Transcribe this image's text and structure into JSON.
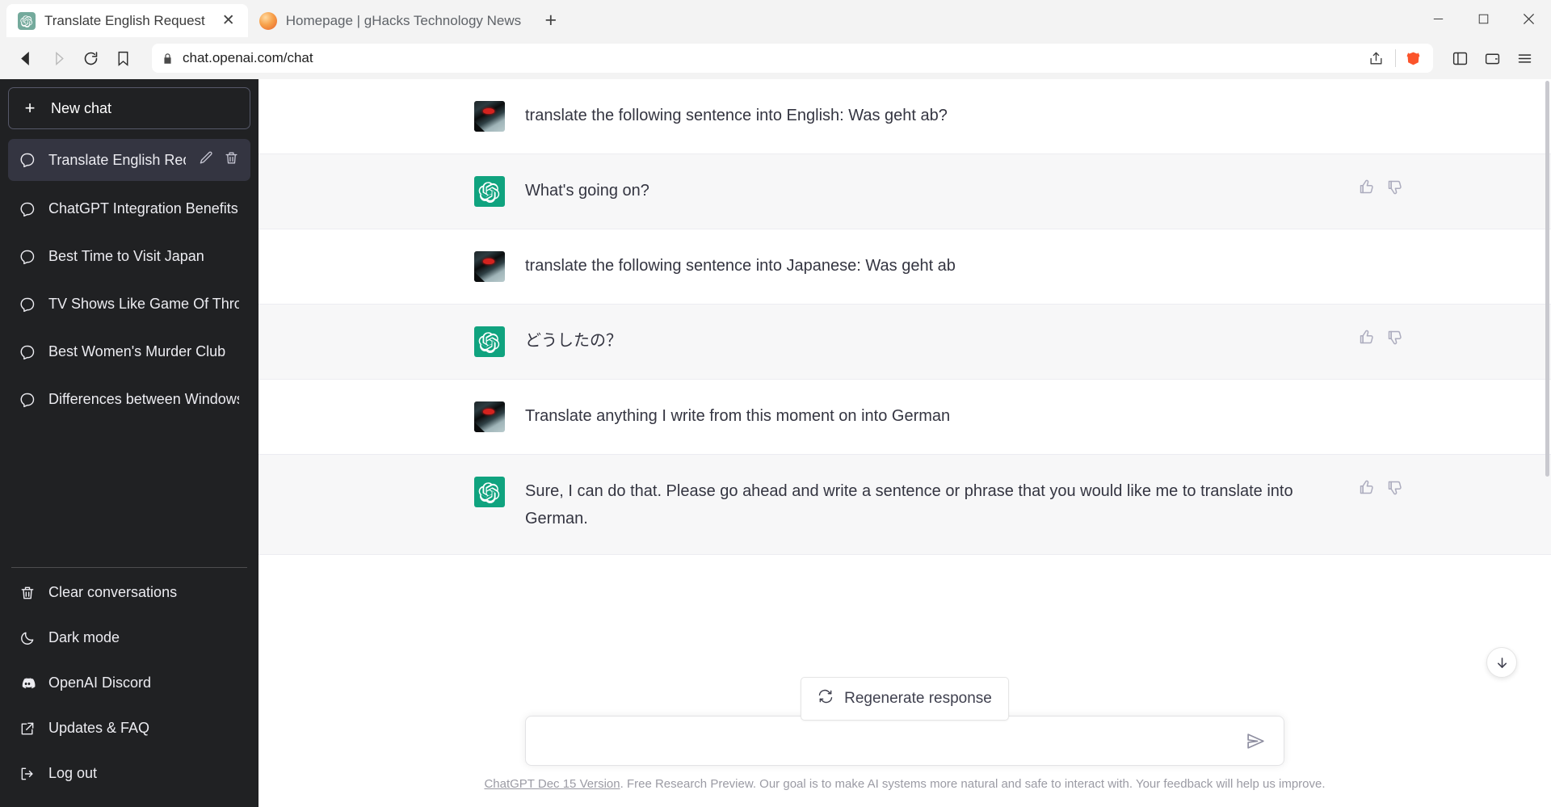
{
  "browser": {
    "tabs": [
      {
        "title": "Translate English Request",
        "favicon": "openai-icon",
        "active": true,
        "close_label": "✕"
      },
      {
        "title": "Homepage | gHacks Technology News",
        "favicon": "ghacks-icon",
        "active": false,
        "close_label": ""
      }
    ],
    "new_tab_label": "+",
    "window_controls": {
      "minimize": "minimize-icon",
      "maximize": "maximize-icon",
      "close": "close-icon"
    },
    "toolbar": {
      "back": "back-arrow-icon",
      "forward": "forward-arrow-icon",
      "reload": "reload-icon",
      "bookmark": "bookmark-icon",
      "url": "chat.openai.com/chat",
      "lock": "lock-icon",
      "share": "share-icon",
      "brave_shields": "brave-lion-icon",
      "sidebar_toggle": "sidebar-panel-icon",
      "wallet": "wallet-icon",
      "menu": "hamburger-menu-icon"
    }
  },
  "sidebar": {
    "new_chat_label": "New chat",
    "new_chat_plus": "+",
    "conversations": [
      {
        "label": "Translate English Reque",
        "active": true,
        "icon": "chat-bubble-icon",
        "edit": "pencil-icon",
        "delete": "trash-icon"
      },
      {
        "label": "ChatGPT Integration Benefits",
        "active": false,
        "icon": "chat-bubble-icon"
      },
      {
        "label": "Best Time to Visit Japan",
        "active": false,
        "icon": "chat-bubble-icon"
      },
      {
        "label": "TV Shows Like Game Of Thron",
        "active": false,
        "icon": "chat-bubble-icon"
      },
      {
        "label": "Best Women's Murder Club",
        "active": false,
        "icon": "chat-bubble-icon"
      },
      {
        "label": "Differences between Windows",
        "active": false,
        "icon": "chat-bubble-icon"
      }
    ],
    "menu": [
      {
        "label": "Clear conversations",
        "icon": "trash-icon"
      },
      {
        "label": "Dark mode",
        "icon": "moon-icon"
      },
      {
        "label": "OpenAI Discord",
        "icon": "discord-icon"
      },
      {
        "label": "Updates & FAQ",
        "icon": "external-link-icon"
      },
      {
        "label": "Log out",
        "icon": "logout-icon"
      }
    ]
  },
  "chat": {
    "messages": [
      {
        "role": "user",
        "text": "translate the following sentence into English: Was geht ab?"
      },
      {
        "role": "assistant",
        "text": "What's going on?",
        "thumbs_up": "thumbs-up-icon",
        "thumbs_down": "thumbs-down-icon"
      },
      {
        "role": "user",
        "text": "translate the following sentence into Japanese: Was geht ab"
      },
      {
        "role": "assistant",
        "text": "どうしたの？",
        "thumbs_up": "thumbs-up-icon",
        "thumbs_down": "thumbs-down-icon"
      },
      {
        "role": "user",
        "text": "Translate anything I write from this moment on into German"
      },
      {
        "role": "assistant",
        "text": "Sure, I can do that. Please go ahead and write a sentence or phrase that you would like me to translate into German.",
        "thumbs_up": "thumbs-up-icon",
        "thumbs_down": "thumbs-down-icon"
      }
    ],
    "regenerate_label": "Regenerate response",
    "regenerate_icon": "refresh-icon",
    "scroll_down_icon": "arrow-down-icon",
    "composer": {
      "value": "",
      "placeholder": "",
      "send_icon": "send-icon"
    },
    "footer": {
      "link_text": "ChatGPT Dec 15 Version",
      "rest_text": ". Free Research Preview. Our goal is to make AI systems more natural and safe to interact with. Your feedback will help us improve."
    }
  },
  "colors": {
    "sidebar_bg": "#202123",
    "sidebar_active": "#343541",
    "assistant_bg": "#f7f7f8",
    "brand_green": "#10a37f",
    "text_primary": "#343541"
  }
}
